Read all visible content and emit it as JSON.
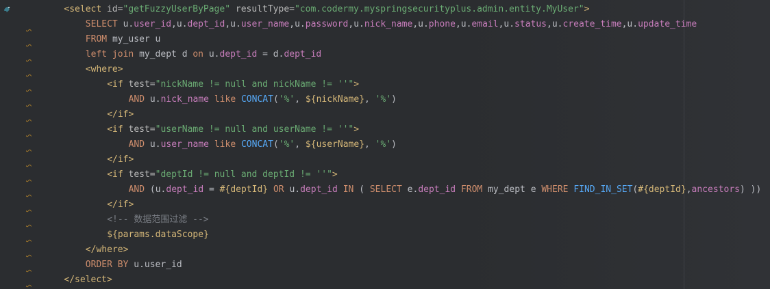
{
  "editor": {
    "lines": [
      [
        {
          "c": "tag",
          "t": "<select "
        },
        {
          "c": "attr",
          "t": "id="
        },
        {
          "c": "str",
          "t": "\"getFuzzyUserByPage\""
        },
        {
          "c": "attr",
          "t": " resultType="
        },
        {
          "c": "str",
          "t": "\"com.codermy.myspringsecurityplus.admin.entity.MyUser\""
        },
        {
          "c": "tag",
          "t": ">"
        }
      ],
      [
        {
          "c": "kw",
          "t": "SELECT "
        },
        {
          "c": "plain",
          "t": "u."
        },
        {
          "c": "ident",
          "t": "user_id"
        },
        {
          "c": "plain",
          "t": ",u."
        },
        {
          "c": "ident",
          "t": "dept_id"
        },
        {
          "c": "plain",
          "t": ",u."
        },
        {
          "c": "ident",
          "t": "user_name"
        },
        {
          "c": "plain",
          "t": ",u."
        },
        {
          "c": "ident",
          "t": "password"
        },
        {
          "c": "plain",
          "t": ",u."
        },
        {
          "c": "ident",
          "t": "nick_name"
        },
        {
          "c": "plain",
          "t": ",u."
        },
        {
          "c": "ident",
          "t": "phone"
        },
        {
          "c": "plain",
          "t": ",u."
        },
        {
          "c": "ident",
          "t": "email"
        },
        {
          "c": "plain",
          "t": ",u."
        },
        {
          "c": "ident",
          "t": "status"
        },
        {
          "c": "plain",
          "t": ",u."
        },
        {
          "c": "ident",
          "t": "create_time"
        },
        {
          "c": "plain",
          "t": ",u."
        },
        {
          "c": "ident",
          "t": "update_time"
        }
      ],
      [
        {
          "c": "kw",
          "t": "FROM "
        },
        {
          "c": "plain",
          "t": "my_user u"
        }
      ],
      [
        {
          "c": "kw",
          "t": "left join "
        },
        {
          "c": "plain",
          "t": "my_dept d "
        },
        {
          "c": "kw",
          "t": "on "
        },
        {
          "c": "plain",
          "t": "u."
        },
        {
          "c": "ident",
          "t": "dept_id"
        },
        {
          "c": "plain",
          "t": " = d."
        },
        {
          "c": "ident",
          "t": "dept_id"
        }
      ],
      [
        {
          "c": "tag",
          "t": "<where>"
        }
      ],
      [
        {
          "c": "tag",
          "t": "<if "
        },
        {
          "c": "attr",
          "t": "test="
        },
        {
          "c": "str",
          "t": "\"nickName != null and nickName != ''\""
        },
        {
          "c": "tag",
          "t": ">"
        }
      ],
      [
        {
          "c": "kw",
          "t": "AND "
        },
        {
          "c": "plain",
          "t": "u."
        },
        {
          "c": "ident",
          "t": "nick_name"
        },
        {
          "c": "kw",
          "t": " like "
        },
        {
          "c": "fn",
          "t": "CONCAT"
        },
        {
          "c": "plain",
          "t": "("
        },
        {
          "c": "str",
          "t": "'%'"
        },
        {
          "c": "plain",
          "t": ", "
        },
        {
          "c": "expr",
          "t": "${nickName}"
        },
        {
          "c": "plain",
          "t": ", "
        },
        {
          "c": "str",
          "t": "'%'"
        },
        {
          "c": "plain",
          "t": ")"
        }
      ],
      [
        {
          "c": "tag",
          "t": "</if>"
        }
      ],
      [
        {
          "c": "tag",
          "t": "<if "
        },
        {
          "c": "attr",
          "t": "test="
        },
        {
          "c": "str",
          "t": "\"userName != null and userName != ''\""
        },
        {
          "c": "tag",
          "t": ">"
        }
      ],
      [
        {
          "c": "kw",
          "t": "AND "
        },
        {
          "c": "plain",
          "t": "u."
        },
        {
          "c": "ident",
          "t": "user_name"
        },
        {
          "c": "kw",
          "t": " like "
        },
        {
          "c": "fn",
          "t": "CONCAT"
        },
        {
          "c": "plain",
          "t": "("
        },
        {
          "c": "str",
          "t": "'%'"
        },
        {
          "c": "plain",
          "t": ", "
        },
        {
          "c": "expr",
          "t": "${userName}"
        },
        {
          "c": "plain",
          "t": ", "
        },
        {
          "c": "str",
          "t": "'%'"
        },
        {
          "c": "plain",
          "t": ")"
        }
      ],
      [
        {
          "c": "tag",
          "t": "</if>"
        }
      ],
      [
        {
          "c": "tag",
          "t": "<if "
        },
        {
          "c": "attr",
          "t": "test="
        },
        {
          "c": "str",
          "t": "\"deptId != null and deptId != ''\""
        },
        {
          "c": "tag",
          "t": ">"
        }
      ],
      [
        {
          "c": "kw",
          "t": "AND "
        },
        {
          "c": "plain",
          "t": "(u."
        },
        {
          "c": "ident",
          "t": "dept_id"
        },
        {
          "c": "plain",
          "t": " = "
        },
        {
          "c": "expr",
          "t": "#{deptId}"
        },
        {
          "c": "kw",
          "t": " OR "
        },
        {
          "c": "plain",
          "t": "u."
        },
        {
          "c": "ident",
          "t": "dept_id"
        },
        {
          "c": "kw",
          "t": " IN "
        },
        {
          "c": "plain",
          "t": "( "
        },
        {
          "c": "kw",
          "t": "SELECT "
        },
        {
          "c": "plain",
          "t": "e."
        },
        {
          "c": "ident",
          "t": "dept_id"
        },
        {
          "c": "kw",
          "t": " FROM "
        },
        {
          "c": "plain",
          "t": "my_dept e "
        },
        {
          "c": "kw",
          "t": "WHERE "
        },
        {
          "c": "fn",
          "t": "FIND_IN_SET"
        },
        {
          "c": "plain",
          "t": "("
        },
        {
          "c": "expr",
          "t": "#{deptId}"
        },
        {
          "c": "plain",
          "t": ","
        },
        {
          "c": "ident",
          "t": "ancestors"
        },
        {
          "c": "plain",
          "t": ") ))"
        }
      ],
      [
        {
          "c": "tag",
          "t": "</if>"
        }
      ],
      [
        {
          "c": "comment",
          "t": "<!-- 数据范围过滤 -->"
        }
      ],
      [
        {
          "c": "expr",
          "t": "${params.dataScope}"
        }
      ],
      [
        {
          "c": "tag",
          "t": "</where>"
        }
      ],
      [
        {
          "c": "kw",
          "t": "ORDER BY "
        },
        {
          "c": "plain",
          "t": "u.user_id"
        }
      ],
      [
        {
          "c": "tag",
          "t": "</select>"
        }
      ]
    ],
    "indents": [
      4,
      8,
      8,
      8,
      8,
      12,
      16,
      12,
      12,
      16,
      12,
      12,
      16,
      12,
      12,
      12,
      8,
      8,
      4
    ],
    "wavy_lines": [
      1,
      2,
      3,
      4,
      5,
      6,
      7,
      8,
      9,
      10,
      11,
      12,
      13,
      14,
      15,
      16,
      17,
      18
    ]
  },
  "colors": {
    "background": "#2b2d30",
    "tag": "#d5b778",
    "keyword": "#cf8e6d",
    "string": "#6aab73",
    "identifier": "#c77dbb",
    "function": "#56a8f5",
    "comment": "#7a7e85",
    "text": "#bcbec4"
  },
  "gutter": {
    "icon": "mybatis-bird-icon"
  }
}
